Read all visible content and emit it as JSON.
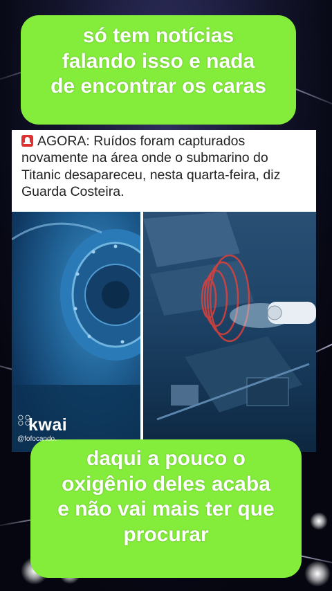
{
  "caption_top": {
    "lines": [
      "só tem notícias",
      "falando isso e nada",
      "de encontrar os caras"
    ]
  },
  "post": {
    "alert_icon": "siren-emoji",
    "text_lines": [
      "AGORA: Ruídos foram capturados",
      "novamente na área onde o submarino do",
      "Titanic desapareceu, nesta quarta-feira, diz",
      "Guarda Costeira."
    ]
  },
  "watermark": {
    "brand": "kwai",
    "handle": "@fofocando."
  },
  "caption_bottom": {
    "lines": [
      "daqui a pouco o",
      "oxigênio deles acaba",
      "e não vai mais ter que",
      "procurar"
    ]
  },
  "colors": {
    "caption_bg": "#84ec3a",
    "caption_text": "#ffffff",
    "alert_red": "#e03131"
  }
}
